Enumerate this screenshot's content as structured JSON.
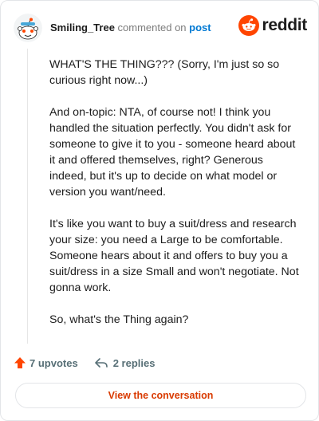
{
  "comment": {
    "username": "Smiling_Tree",
    "action_text": "commented on",
    "post_link_label": "post",
    "paragraphs": [
      "WHAT'S THE THING??? (Sorry, I'm just so so curious right now...)",
      "And on-topic: NTA, of course not! I think you handled the situation perfectly. You didn't ask for someone to give it to you - someone heard about it and offered themselves, right? Generous indeed, but it's up to decide on what model or version you want/need.",
      "It's like you want to buy a suit/dress and research your size: you need a Large to be comfortable. Someone hears about it and offers to buy you a suit/dress in a size Small and won't negotiate. Not gonna work.",
      "So, what's the Thing again?"
    ]
  },
  "brand": {
    "wordmark": "reddit",
    "icon": "reddit-snoo-icon",
    "color": "#ff4500"
  },
  "footer": {
    "upvotes_label": "7 upvotes",
    "upvote_icon": "upvote-arrow-icon",
    "replies_label": "2 replies",
    "reply_icon": "reply-arrow-icon"
  },
  "cta": {
    "view_conversation_label": "View the conversation"
  },
  "colors": {
    "accent": "#ff4500",
    "link": "#0079d3",
    "cta_text": "#d93a00",
    "muted": "#576f76"
  }
}
